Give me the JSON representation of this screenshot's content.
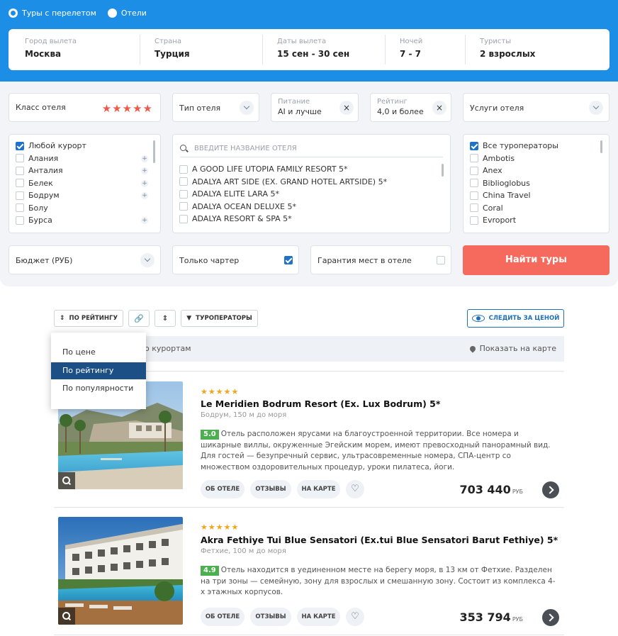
{
  "search": {
    "mode_flights": "Туры с перелетом",
    "mode_hotels": "Отели",
    "fields": [
      {
        "label": "Город вылета",
        "value": "Москва"
      },
      {
        "label": "Страна",
        "value": "Турция"
      },
      {
        "label": "Даты вылета",
        "value": "15 сен - 30 сен"
      },
      {
        "label": "Ночей",
        "value": "7 - 7"
      },
      {
        "label": "Туристы",
        "value": "2 взрослых"
      }
    ]
  },
  "filters": {
    "hotel_class_label": "Класс отеля",
    "hotel_class_stars": "★★★★★",
    "hotel_type_label": "Тип отеля",
    "meal_label": "Питание",
    "meal_value": "AI и лучше",
    "rating_label": "Рейтинг",
    "rating_value": "4,0 и более",
    "services_label": "Услуги отеля",
    "resorts": [
      "Любой курорт",
      "Алания",
      "Анталия",
      "Белек",
      "Бодрум",
      "Болу",
      "Бурса"
    ],
    "hotel_search_placeholder": "ВВЕДИТЕ НАЗВАНИЕ ОТЕЛЯ",
    "hotels": [
      "A GOOD LIFE UTOPIA FAMILY RESORT 5*",
      "ADALYA ART SIDE (EX. GRAND HOTEL ARTSIDE) 5*",
      "ADALYA ELITE LARA 5*",
      "ADALYA OCEAN DELUXE 5*",
      "ADALYA RESORT & SPA 5*"
    ],
    "operators": [
      "Все туроператоры",
      "Ambotis",
      "Anex",
      "Biblioglobus",
      "China Travel",
      "Coral",
      "Evroport"
    ],
    "budget_label": "Бюджет (РУБ)",
    "charter_label": "Только чартер",
    "guarantee_label": "Гарантия мест в отеле",
    "find_button": "Найти туры"
  },
  "toolbar": {
    "sort_label": "ПО РЕЙТИНГУ",
    "operators_label": "ТУРОПЕРАТОРЫ",
    "watch_price_label": "СЛЕДИТЬ ЗА ЦЕНОЙ",
    "resorts_text": "о курортам",
    "map_text": "Показать на карте"
  },
  "sort_menu": [
    "По цене",
    "По рейтингу",
    "По популярности"
  ],
  "hotels": [
    {
      "stars": "★★★★★",
      "name": "Le Meridien Bodrum Resort (Ex. Lux Bodrum) 5*",
      "location": "Бодрум, 150 м до моря",
      "score": "5.0",
      "description": "Отель расположен ярусами на благоустроенной территории. Все номера и шикарные виллы, окруженные Эгейским морем, имеют превосходный панорамный вид. Для гостей — безупречный сервис, ультрасовременные номера, СПА-центр со множеством оздоровительных процедур, уроки пилатеса, йоги.",
      "price": "703 440",
      "currency": "РУБ"
    },
    {
      "stars": "★★★★★",
      "name": "Akra Fethiye Tui Blue Sensatori (Ex.tui Blue Sensatori Barut Fethiye) 5*",
      "location": "Фетхие, 100 м до моря",
      "score": "4.9",
      "description": "Отель находится в уединенном месте на берегу моря, в 13 км от Фетхие. Разделен на три зоны — семейную, зону для взрослых и смешанную зону. Состоит из комплекса 4-х этажных корпусов.",
      "price": "353 794",
      "currency": "РУБ"
    }
  ],
  "card_buttons": {
    "about": "ОБ ОТЕЛЕ",
    "reviews": "ОТЗЫВЫ",
    "map": "НА КАРТЕ"
  }
}
